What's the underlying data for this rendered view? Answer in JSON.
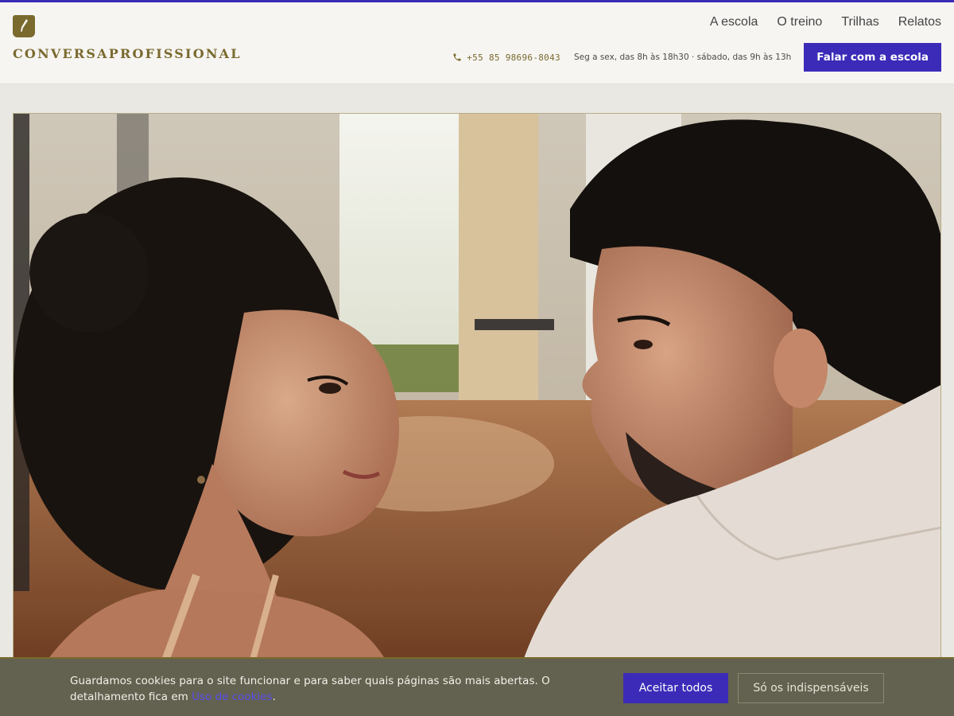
{
  "brand": {
    "name": "CONVERSAPROFISSIONAL",
    "logo_icon": "quill-shield-icon",
    "color": "#7a6a2e"
  },
  "nav": {
    "items": [
      {
        "label": "A escola"
      },
      {
        "label": "O treino"
      },
      {
        "label": "Trilhas"
      },
      {
        "label": "Relatos"
      }
    ]
  },
  "contact": {
    "phone_icon": "phone-icon",
    "phone": "+55 85 98696-8043",
    "hours": "Seg a sex, das 8h às 18h30 · sábado, das 9h às 13h",
    "cta_label": "Falar com a escola"
  },
  "hero": {
    "image": "photo-woman-and-man-facing-each-other-in-studio"
  },
  "cookie_banner": {
    "text_before": "Guardamos cookies para o site funcionar e para saber quais páginas são mais abertas. O detalhamento fica em ",
    "link_label": "Uso de cookies",
    "text_after": ".",
    "accept_label": "Aceitar todos",
    "essential_label": "Só os indispensáveis"
  },
  "colors": {
    "accent": "#3b2bb8",
    "brand_gold": "#7a6a2e",
    "cookie_bg": "#63614f"
  }
}
